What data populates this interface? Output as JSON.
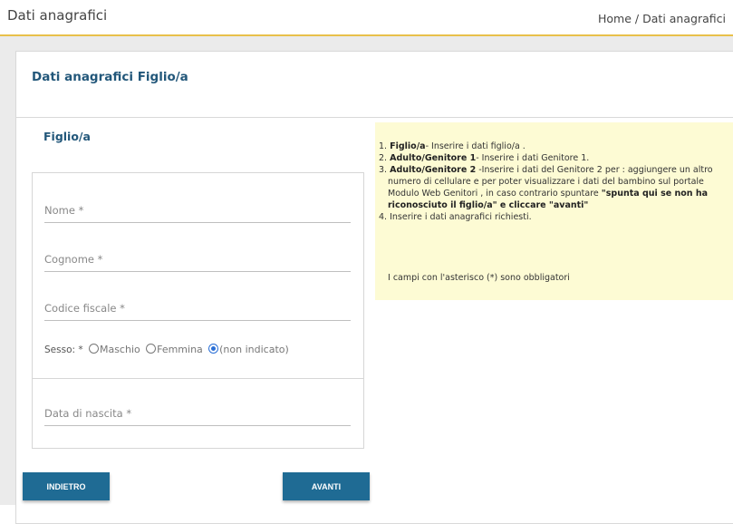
{
  "header": {
    "title": "Dati anagrafici",
    "breadcrumb": {
      "home": "Home",
      "separator": "/",
      "current": "Dati anagrafici"
    }
  },
  "panel": {
    "title": "Dati anagrafici Figlio/a",
    "section_title": "Figlio/a"
  },
  "form": {
    "nome_label": "Nome *",
    "cognome_label": "Cognome *",
    "codice_fiscale_label": "Codice fiscale *",
    "sesso": {
      "label": "Sesso: *",
      "options": [
        "Maschio",
        "Femmina",
        "(non indicato)"
      ],
      "selected": "(non indicato)"
    },
    "data_nascita_label": "Data di nascita *"
  },
  "info": {
    "items": [
      {
        "num": "1.",
        "bold": "Figlio/a",
        "text": "-  Inserire i dati figlio/a ."
      },
      {
        "num": "2.",
        "bold": "Adulto/Genitore 1",
        "text": "-  Inserire i dati Genitore 1."
      },
      {
        "num": "3.",
        "bold": "Adulto/Genitore 2",
        "text": "  -Inserire i dati del Genitore 2 per : aggiungere un altro numero di cellulare e per poter visualizzare i dati del bambino sul portale Modulo     Web  Genitori , in caso contrario spuntare ",
        "bold2": "\"spunta qui se non ha riconosciuto il figlio/a\" e cliccare \"avanti\""
      },
      {
        "num": "4.",
        "text": "Inserire i dati anagrafici richiesti."
      }
    ],
    "note": "I campi con l'asterisco (*) sono obbligatori"
  },
  "buttons": {
    "back": "INDIETRO",
    "next": "AVANTI"
  },
  "colors": {
    "accent_line": "#e8c04a",
    "title_blue": "#22577a",
    "button_blue": "#1f6b94",
    "info_bg": "#fdfbd4",
    "radio_selected": "#2a6fd6"
  }
}
